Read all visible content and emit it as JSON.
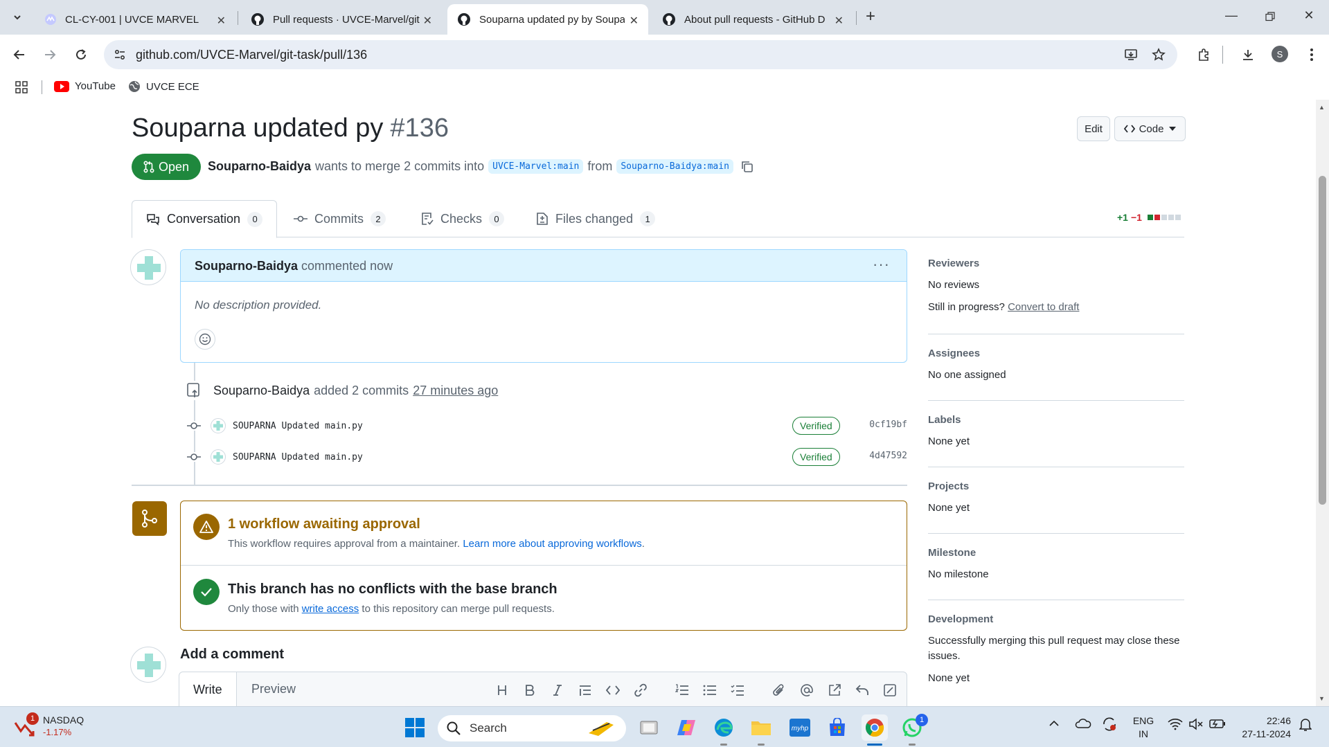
{
  "browser": {
    "tabs": [
      {
        "title": "CL-CY-001 | UVCE MARVEL",
        "active": false
      },
      {
        "title": "Pull requests · UVCE-Marvel/git",
        "active": false
      },
      {
        "title": "Souparna updated py by Soupa",
        "active": true
      },
      {
        "title": "About pull requests - GitHub D",
        "active": false
      }
    ],
    "url": "github.com/UVCE-Marvel/git-task/pull/136",
    "profile_initial": "S",
    "bookmarks": [
      {
        "label": "YouTube",
        "icon": "youtube-icon"
      },
      {
        "label": "UVCE ECE",
        "icon": "globe-icon"
      }
    ]
  },
  "pr": {
    "title": "Souparna updated py",
    "number": "#136",
    "edit_label": "Edit",
    "code_label": "Code",
    "state": "Open",
    "author": "Souparno-Baidya",
    "merge_text": "wants to merge 2 commits into",
    "base_branch": "UVCE-Marvel:main",
    "from_text": "from",
    "head_branch": "Souparno-Baidya:main",
    "diff_add": "+1",
    "diff_del": "−1",
    "tabs": [
      {
        "label": "Conversation",
        "count": "0",
        "icon": "comment-discussion-icon"
      },
      {
        "label": "Commits",
        "count": "2",
        "icon": "commit-icon"
      },
      {
        "label": "Checks",
        "count": "0",
        "icon": "checklist-icon"
      },
      {
        "label": "Files changed",
        "count": "1",
        "icon": "file-diff-icon"
      }
    ]
  },
  "comment": {
    "author": "Souparno-Baidya",
    "action": "commented now",
    "body": "No description provided."
  },
  "commits_event": {
    "author": "Souparno-Baidya",
    "text": "added 2 commits",
    "time": "27 minutes ago",
    "commits": [
      {
        "message": "SOUPARNA Updated main.py",
        "badge": "Verified",
        "sha": "0cf19bf"
      },
      {
        "message": "SOUPARNA Updated main.py",
        "badge": "Verified",
        "sha": "4d47592"
      }
    ]
  },
  "merge_box": {
    "workflow_title": "1 workflow awaiting approval",
    "workflow_text": "This workflow requires approval from a maintainer.",
    "workflow_link": "Learn more about approving workflows",
    "workflow_period": ".",
    "conflict_title": "This branch has no conflicts with the base branch",
    "conflict_text_pre": "Only those with",
    "conflict_link": "write access",
    "conflict_text_post": "to this repository can merge pull requests."
  },
  "add_comment": {
    "title": "Add a comment",
    "write_tab": "Write",
    "preview_tab": "Preview"
  },
  "sidebar": {
    "reviewers_title": "Reviewers",
    "reviewers_value": "No reviews",
    "progress_text": "Still in progress?",
    "progress_link": "Convert to draft",
    "assignees_title": "Assignees",
    "assignees_value": "No one assigned",
    "labels_title": "Labels",
    "labels_value": "None yet",
    "projects_title": "Projects",
    "projects_value": "None yet",
    "milestone_title": "Milestone",
    "milestone_value": "No milestone",
    "development_title": "Development",
    "development_text": "Successfully merging this pull request may close these issues.",
    "development_value": "None yet"
  },
  "taskbar": {
    "stock_name": "NASDAQ",
    "stock_change": "-1.17%",
    "stock_badge": "1",
    "search_label": "Search",
    "whatsapp_badge": "1",
    "lang_line1": "ENG",
    "lang_line2": "IN",
    "time": "22:46",
    "date": "27-11-2024"
  },
  "colors": {
    "open_green": "#1f883d",
    "link_blue": "#0969da",
    "attention_brown": "#9a6700",
    "success_green": "#1a7f37",
    "danger_red": "#d1242f"
  }
}
